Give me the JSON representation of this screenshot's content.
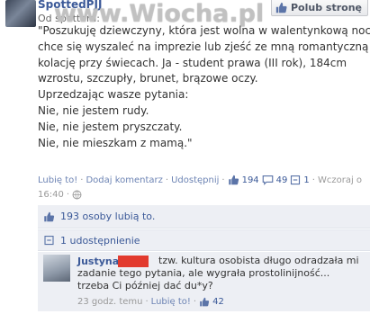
{
  "header": {
    "page_name": "SpottedPJJ",
    "like_page_label": "Polub stronę",
    "watermark": "www.Wiocha.pl",
    "subhead": "Od spottera:"
  },
  "post": {
    "lines": [
      "\"Poszukuję dziewczyny, która jest wolna w walentynkową noc i",
      "chce się wyszaleć na imprezie lub zjeść ze mną romantyczną",
      "kolację przy świecach. Ja - student prawa (III rok), 184cm",
      "wzrostu, szczupły, brunet, brązowe oczy.",
      "Uprzedzając wasze pytania:",
      "Nie, nie jestem rudy.",
      "Nie, nie jestem pryszczaty.",
      "Nie, nie mieszkam z mamą.\""
    ],
    "actions": {
      "like": "Lubię to!",
      "comment": "Dodaj komentarz",
      "share": "Udostępnij",
      "like_count": "194",
      "comment_count": "49",
      "share_count": "1",
      "time_a": "Wczoraj o",
      "time_b": "16:40"
    }
  },
  "likes_panel": {
    "text": "193 osoby lubią to."
  },
  "share_panel": {
    "text": "1 udostępnienie"
  },
  "comment": {
    "author": "Justyna",
    "lines": [
      "tzw. kultura osobista długo odradzała mi",
      "zadanie tego pytania, ale wygrała prostolinijność...",
      "trzeba Ci później dać du*y?"
    ],
    "time": "23 godz. temu",
    "like": "Lubię to!",
    "like_count": "42"
  },
  "colors": {
    "link": "#3b5998",
    "panel_bg": "#edeff4",
    "redaction": "#e23a2e"
  },
  "icons": [
    "thumb-up-icon",
    "comment-icon",
    "share-icon",
    "globe-icon"
  ]
}
